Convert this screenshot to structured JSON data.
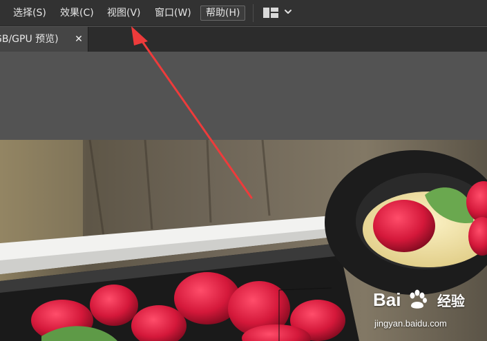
{
  "menubar": {
    "partial_item": ")",
    "items": [
      {
        "label": "选择(S)"
      },
      {
        "label": "效果(C)"
      },
      {
        "label": "视图(V)"
      },
      {
        "label": "窗口(W)"
      },
      {
        "label": "帮助(H)"
      }
    ],
    "workspace_switcher": {
      "icon": "workspace-layout-icon",
      "dropdown_icon": "chevron-down-icon"
    }
  },
  "document_tab": {
    "title": "GB/GPU 预览)",
    "close_glyph": "✕"
  },
  "watermark": {
    "logo_text_left": "Bai",
    "logo_text_right": "经验",
    "url": "jingyan.baidu.com"
  },
  "colors": {
    "menubar_bg": "#323232",
    "tabbar_bg": "#2c2c2c",
    "canvas_bg": "#535353",
    "annotation_arrow": "#ee3b3b"
  }
}
